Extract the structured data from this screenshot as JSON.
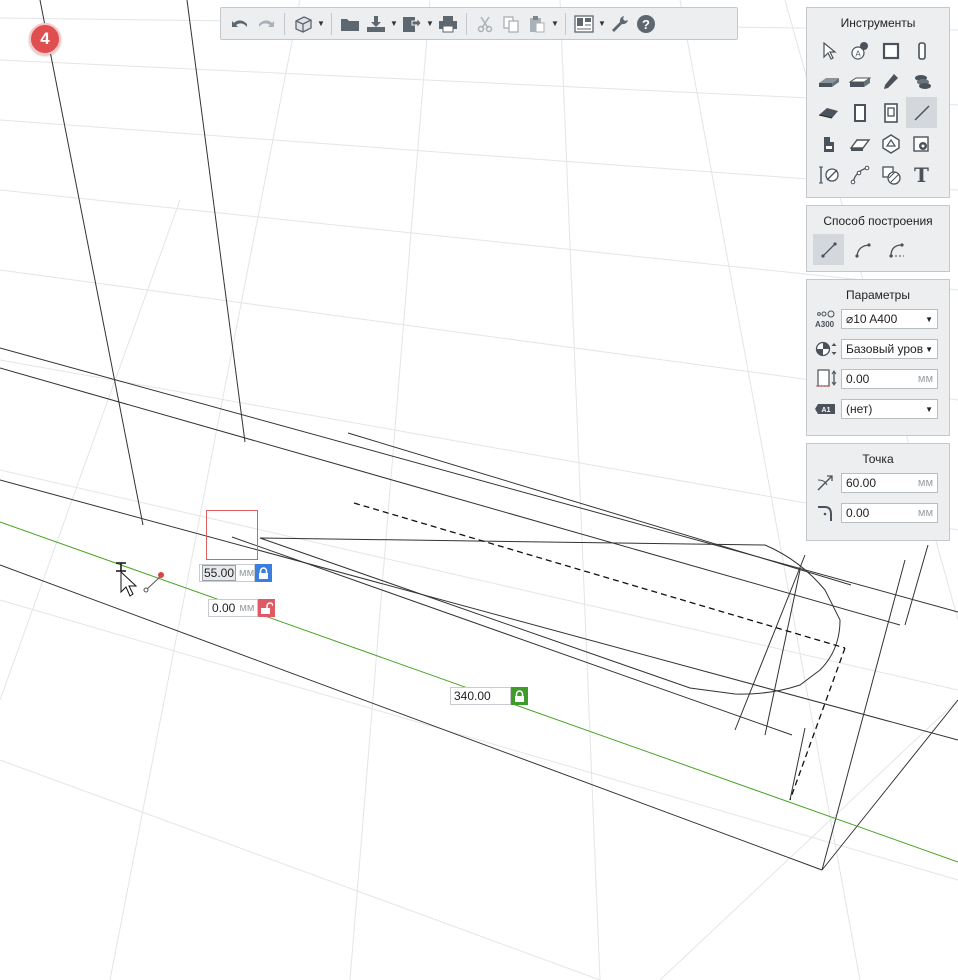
{
  "badge": {
    "number": "4"
  },
  "toolbar": {
    "buttons": [
      "undo-icon",
      "redo-icon",
      "3d-view-icon",
      "open-folder-icon",
      "import-icon",
      "export-icon",
      "print-icon",
      "cut-icon",
      "copy-icon",
      "paste-icon",
      "layout-sheet-icon",
      "settings-wrench-icon",
      "help-icon"
    ]
  },
  "tools_panel": {
    "title": "Инструменты",
    "tools": [
      "select-arrow-icon",
      "annotation-icon",
      "wall-icon",
      "column-icon",
      "slab-icon",
      "beam-icon",
      "pen-icon",
      "rebar-stack-icon",
      "roof-icon",
      "door-icon",
      "window-icon",
      "line-icon",
      "stair-icon",
      "ramp-icon",
      "object-icon",
      "camera-icon",
      "dimension-icon",
      "curve-icon",
      "hatch-icon",
      "text-icon"
    ],
    "text_tool_label": "T",
    "active_tool": "line-icon"
  },
  "method_panel": {
    "title": "Способ построения",
    "methods": [
      "straight-line-icon",
      "arc-line-icon",
      "fillet-line-icon"
    ],
    "active_method": "straight-line-icon"
  },
  "params_panel": {
    "title": "Параметры",
    "rebar_icon_label": "A300",
    "rebar_value": "⌀10 A400",
    "level_value": "Базовый уровень",
    "offset_value": "0.00",
    "offset_unit": "мм",
    "mark_icon_label": "A1",
    "mark_value": "(нет)"
  },
  "point_panel": {
    "title": "Точка",
    "angle_value": "60.00",
    "angle_unit": "мм",
    "radius_value": "0.00",
    "radius_unit": "мм"
  },
  "dimensions": {
    "first": {
      "value": "55.00",
      "unit": "мм",
      "locked": true
    },
    "second": {
      "value": "0.00",
      "unit": "мм",
      "locked": false
    },
    "third": {
      "value": "340.00",
      "locked": true
    }
  },
  "colors": {
    "accent_blue": "#3a7fe0",
    "lock_red": "#e05a66",
    "lock_green": "#3f9b2a",
    "axis_green": "#4aa428",
    "badge_red": "#e04f4f"
  }
}
